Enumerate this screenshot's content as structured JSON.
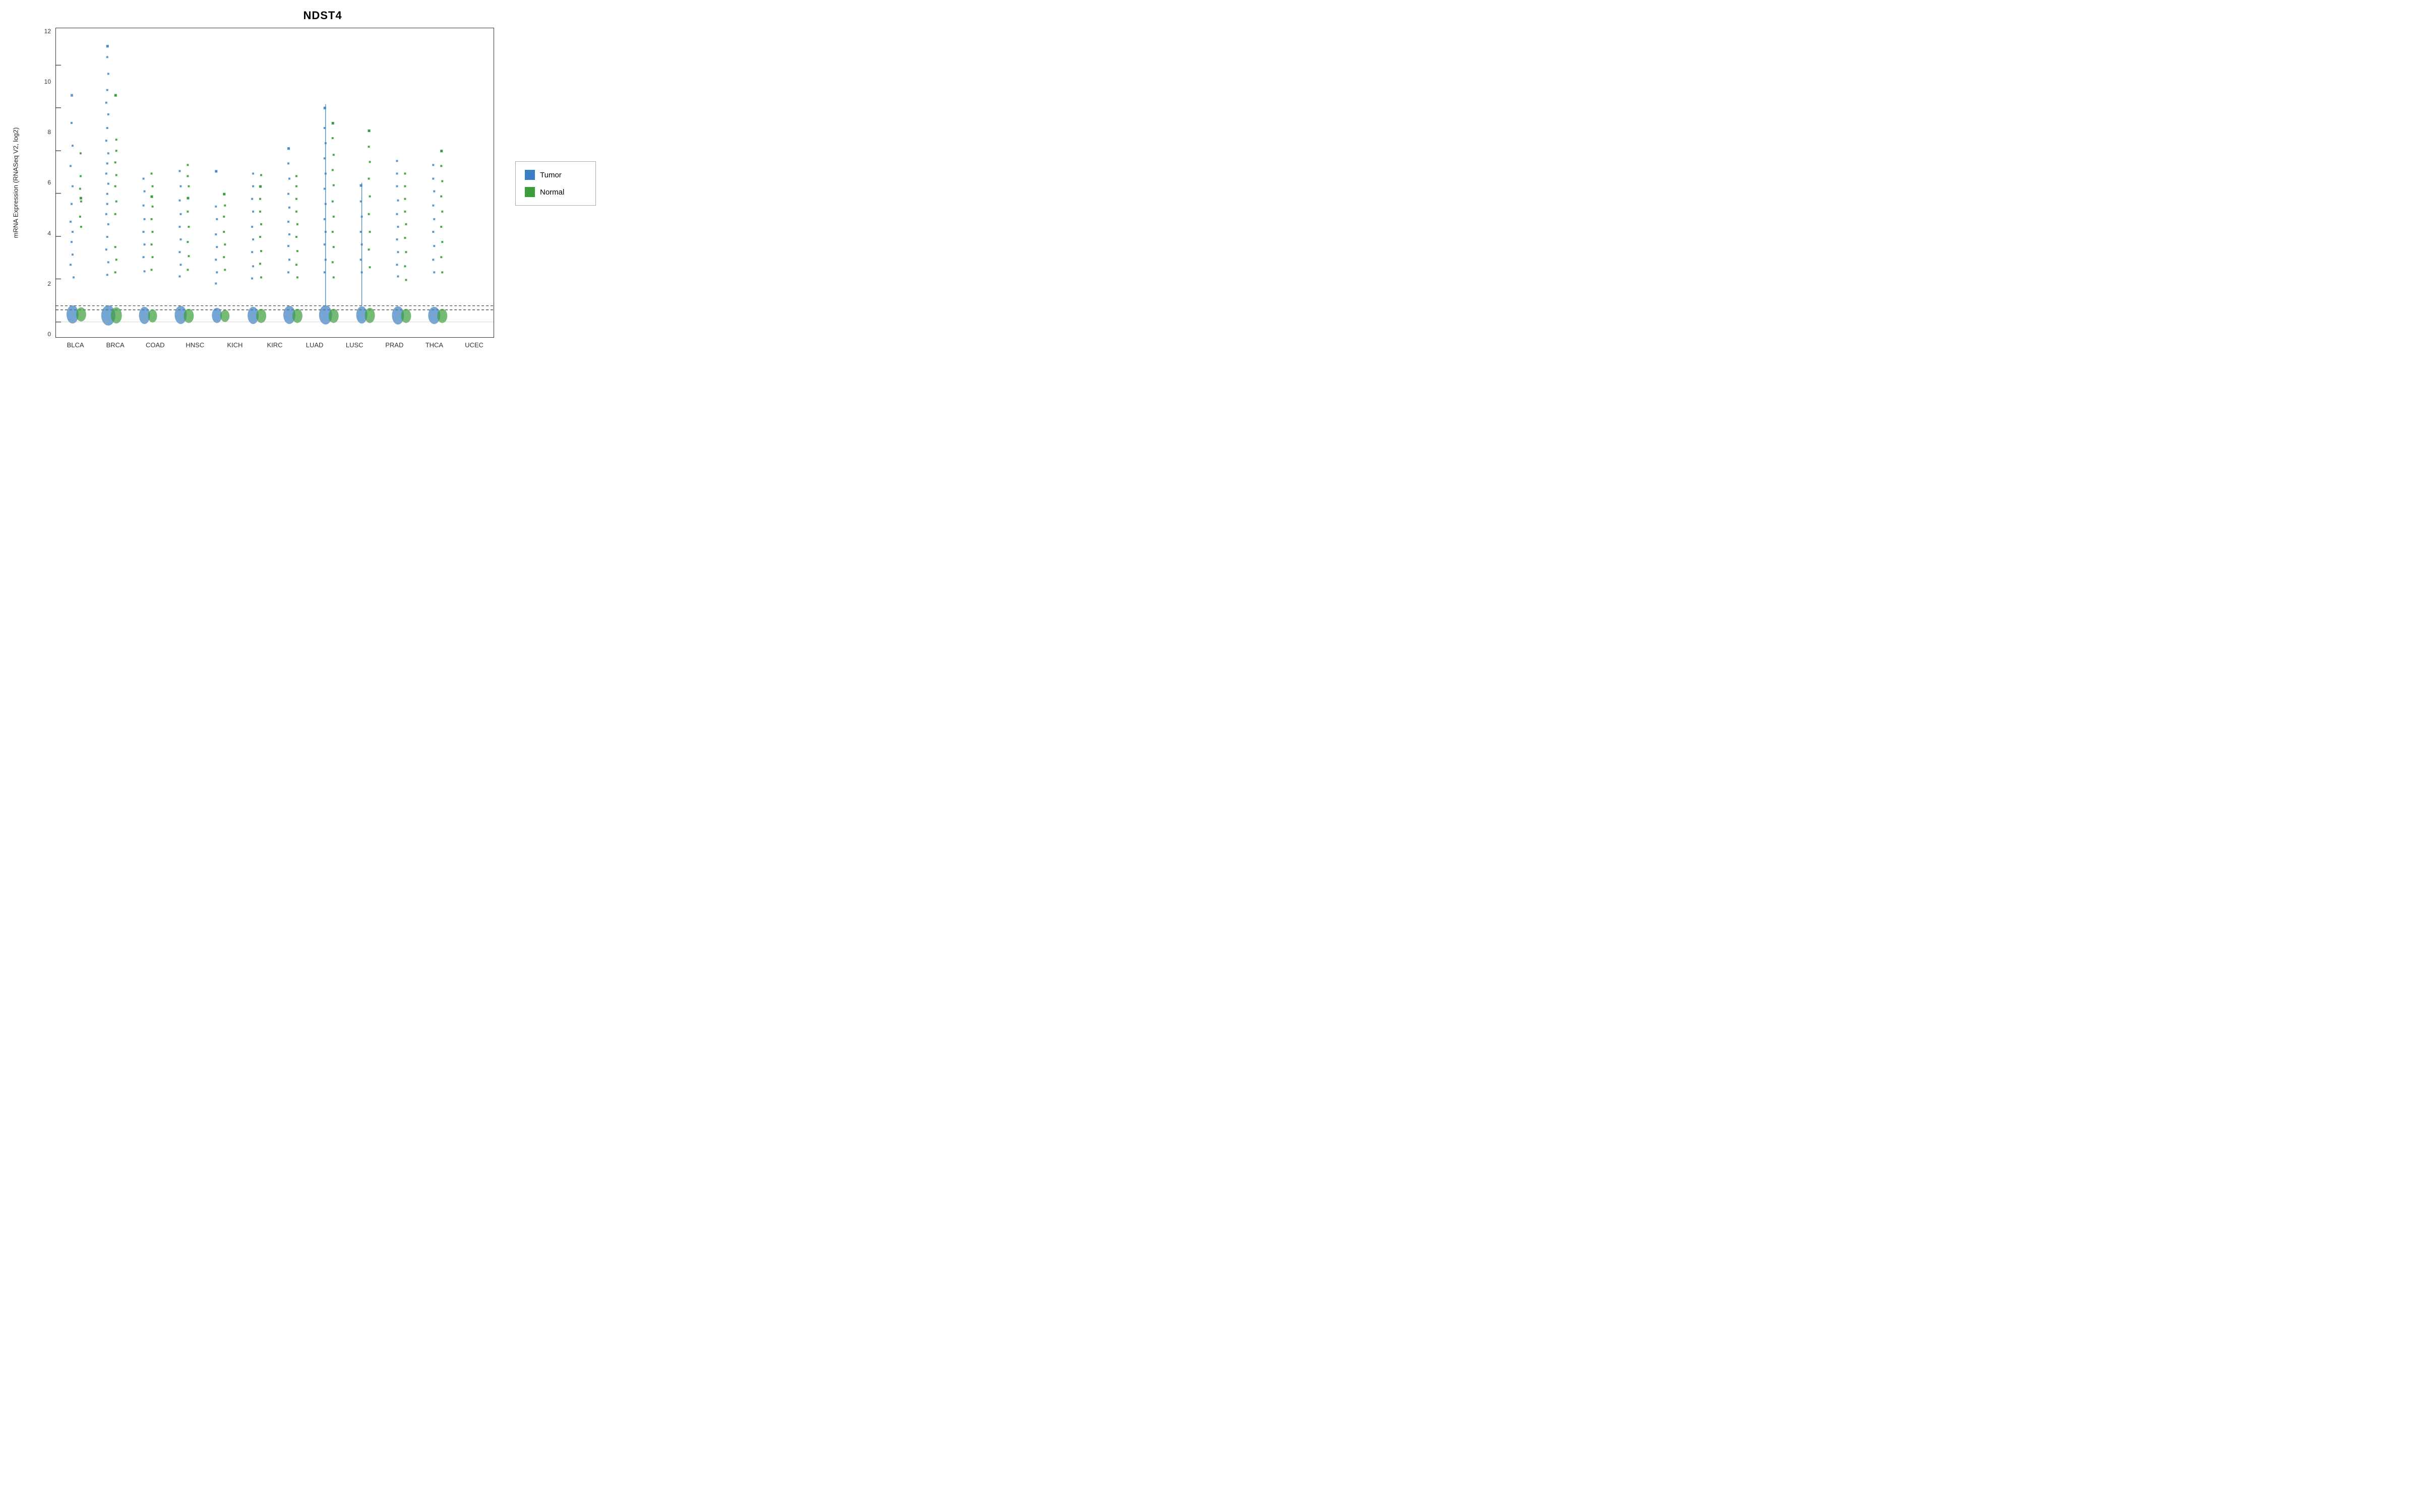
{
  "title": "NDST4",
  "yAxis": {
    "label": "mRNA Expression (RNASeq V2, log2)",
    "ticks": [
      "12",
      "10",
      "8",
      "6",
      "4",
      "2",
      "0"
    ]
  },
  "xAxis": {
    "ticks": [
      "BLCA",
      "BRCA",
      "COAD",
      "HNSC",
      "KICH",
      "KIRC",
      "LUAD",
      "LUSC",
      "PRAD",
      "THCA",
      "UCEC"
    ]
  },
  "legend": {
    "items": [
      {
        "label": "Tumor",
        "color": "#3a7fc1"
      },
      {
        "label": "Normal",
        "color": "#3a9e3a"
      }
    ]
  },
  "colors": {
    "tumor": "#3a7fc1",
    "normal": "#3a9e3a",
    "dottedLine": "#333"
  }
}
